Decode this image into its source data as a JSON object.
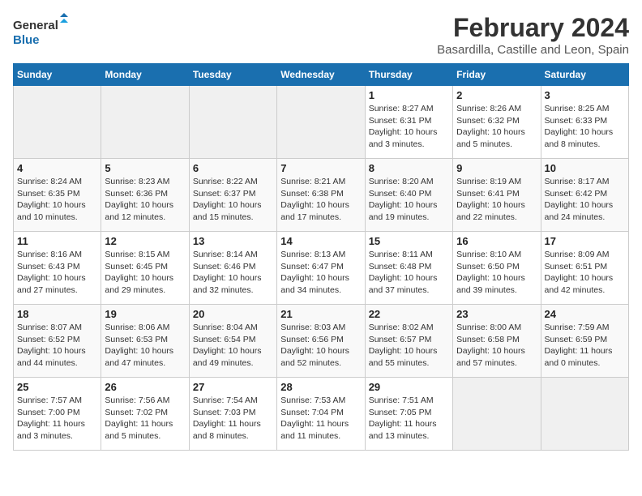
{
  "logo": {
    "line1": "General",
    "line2": "Blue"
  },
  "title": "February 2024",
  "location": "Basardilla, Castille and Leon, Spain",
  "weekdays": [
    "Sunday",
    "Monday",
    "Tuesday",
    "Wednesday",
    "Thursday",
    "Friday",
    "Saturday"
  ],
  "weeks": [
    [
      {
        "day": "",
        "info": ""
      },
      {
        "day": "",
        "info": ""
      },
      {
        "day": "",
        "info": ""
      },
      {
        "day": "",
        "info": ""
      },
      {
        "day": "1",
        "info": "Sunrise: 8:27 AM\nSunset: 6:31 PM\nDaylight: 10 hours\nand 3 minutes."
      },
      {
        "day": "2",
        "info": "Sunrise: 8:26 AM\nSunset: 6:32 PM\nDaylight: 10 hours\nand 5 minutes."
      },
      {
        "day": "3",
        "info": "Sunrise: 8:25 AM\nSunset: 6:33 PM\nDaylight: 10 hours\nand 8 minutes."
      }
    ],
    [
      {
        "day": "4",
        "info": "Sunrise: 8:24 AM\nSunset: 6:35 PM\nDaylight: 10 hours\nand 10 minutes."
      },
      {
        "day": "5",
        "info": "Sunrise: 8:23 AM\nSunset: 6:36 PM\nDaylight: 10 hours\nand 12 minutes."
      },
      {
        "day": "6",
        "info": "Sunrise: 8:22 AM\nSunset: 6:37 PM\nDaylight: 10 hours\nand 15 minutes."
      },
      {
        "day": "7",
        "info": "Sunrise: 8:21 AM\nSunset: 6:38 PM\nDaylight: 10 hours\nand 17 minutes."
      },
      {
        "day": "8",
        "info": "Sunrise: 8:20 AM\nSunset: 6:40 PM\nDaylight: 10 hours\nand 19 minutes."
      },
      {
        "day": "9",
        "info": "Sunrise: 8:19 AM\nSunset: 6:41 PM\nDaylight: 10 hours\nand 22 minutes."
      },
      {
        "day": "10",
        "info": "Sunrise: 8:17 AM\nSunset: 6:42 PM\nDaylight: 10 hours\nand 24 minutes."
      }
    ],
    [
      {
        "day": "11",
        "info": "Sunrise: 8:16 AM\nSunset: 6:43 PM\nDaylight: 10 hours\nand 27 minutes."
      },
      {
        "day": "12",
        "info": "Sunrise: 8:15 AM\nSunset: 6:45 PM\nDaylight: 10 hours\nand 29 minutes."
      },
      {
        "day": "13",
        "info": "Sunrise: 8:14 AM\nSunset: 6:46 PM\nDaylight: 10 hours\nand 32 minutes."
      },
      {
        "day": "14",
        "info": "Sunrise: 8:13 AM\nSunset: 6:47 PM\nDaylight: 10 hours\nand 34 minutes."
      },
      {
        "day": "15",
        "info": "Sunrise: 8:11 AM\nSunset: 6:48 PM\nDaylight: 10 hours\nand 37 minutes."
      },
      {
        "day": "16",
        "info": "Sunrise: 8:10 AM\nSunset: 6:50 PM\nDaylight: 10 hours\nand 39 minutes."
      },
      {
        "day": "17",
        "info": "Sunrise: 8:09 AM\nSunset: 6:51 PM\nDaylight: 10 hours\nand 42 minutes."
      }
    ],
    [
      {
        "day": "18",
        "info": "Sunrise: 8:07 AM\nSunset: 6:52 PM\nDaylight: 10 hours\nand 44 minutes."
      },
      {
        "day": "19",
        "info": "Sunrise: 8:06 AM\nSunset: 6:53 PM\nDaylight: 10 hours\nand 47 minutes."
      },
      {
        "day": "20",
        "info": "Sunrise: 8:04 AM\nSunset: 6:54 PM\nDaylight: 10 hours\nand 49 minutes."
      },
      {
        "day": "21",
        "info": "Sunrise: 8:03 AM\nSunset: 6:56 PM\nDaylight: 10 hours\nand 52 minutes."
      },
      {
        "day": "22",
        "info": "Sunrise: 8:02 AM\nSunset: 6:57 PM\nDaylight: 10 hours\nand 55 minutes."
      },
      {
        "day": "23",
        "info": "Sunrise: 8:00 AM\nSunset: 6:58 PM\nDaylight: 10 hours\nand 57 minutes."
      },
      {
        "day": "24",
        "info": "Sunrise: 7:59 AM\nSunset: 6:59 PM\nDaylight: 11 hours\nand 0 minutes."
      }
    ],
    [
      {
        "day": "25",
        "info": "Sunrise: 7:57 AM\nSunset: 7:00 PM\nDaylight: 11 hours\nand 3 minutes."
      },
      {
        "day": "26",
        "info": "Sunrise: 7:56 AM\nSunset: 7:02 PM\nDaylight: 11 hours\nand 5 minutes."
      },
      {
        "day": "27",
        "info": "Sunrise: 7:54 AM\nSunset: 7:03 PM\nDaylight: 11 hours\nand 8 minutes."
      },
      {
        "day": "28",
        "info": "Sunrise: 7:53 AM\nSunset: 7:04 PM\nDaylight: 11 hours\nand 11 minutes."
      },
      {
        "day": "29",
        "info": "Sunrise: 7:51 AM\nSunset: 7:05 PM\nDaylight: 11 hours\nand 13 minutes."
      },
      {
        "day": "",
        "info": ""
      },
      {
        "day": "",
        "info": ""
      }
    ]
  ]
}
